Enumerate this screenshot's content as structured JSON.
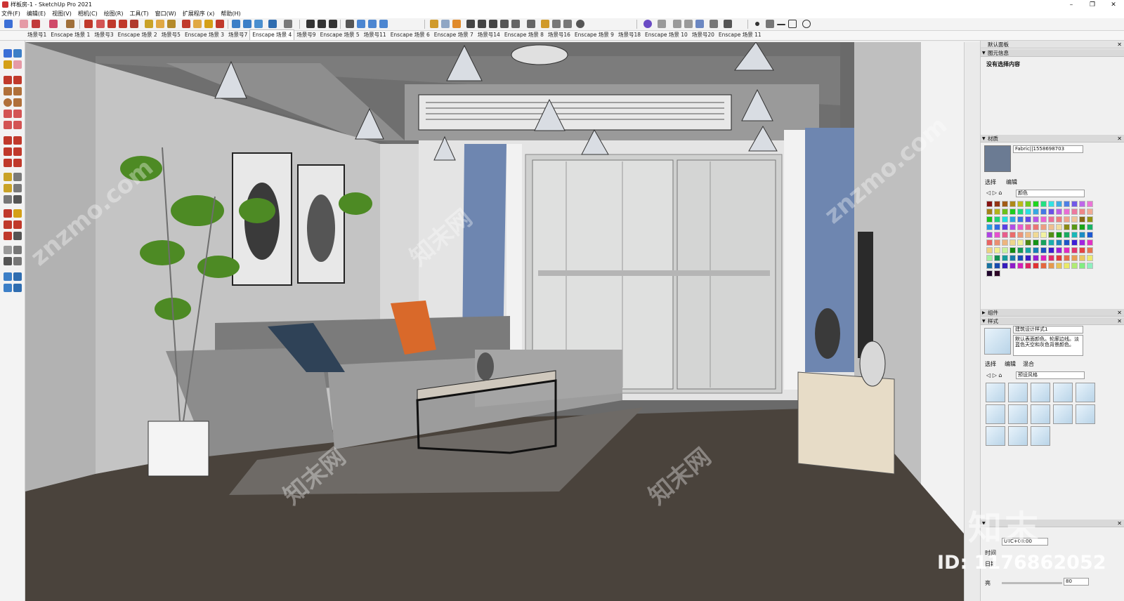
{
  "window": {
    "title": "样板房-1 - SketchUp Pro 2021",
    "minimize": "–",
    "restore": "❐",
    "close": "✕"
  },
  "menu": [
    "文件(F)",
    "编辑(E)",
    "视图(V)",
    "相机(C)",
    "绘图(R)",
    "工具(T)",
    "窗口(W)",
    "扩展程序 (x)",
    "帮助(H)"
  ],
  "scenes": [
    "场景号1",
    "Enscape 场景 1",
    "场景号3",
    "Enscape 场景 2",
    "场景号5",
    "Enscape 场景 3",
    "场景号7",
    "Enscape 场景 4",
    "场景号9",
    "Enscape 场景 5",
    "场景号11",
    "Enscape 场景 6",
    "Enscape 场景 7",
    "场景号14",
    "Enscape 场景 8",
    "场景号16",
    "Enscape 场景 9",
    "场景号18",
    "Enscape 场景 10",
    "场景号20",
    "Enscape 场景 11"
  ],
  "active_scene_index": 7,
  "tray": {
    "default_panel": "默认面板",
    "entity_info": {
      "title": "图元信息",
      "empty": "没有选择内容"
    },
    "materials": {
      "title": "材质",
      "material_name": "Fabric||1558698703",
      "tab_select": "选择",
      "tab_edit": "编辑",
      "library": "颜色",
      "swatch_color": "#6b7b93"
    },
    "components": {
      "title": "组件"
    },
    "styles": {
      "title": "样式",
      "style_name": "建筑设计样式1",
      "description": "默认表面颜色。轮廓边线。淡蓝色天空和灰色背景颜色。",
      "tab_select": "选择",
      "tab_edit": "编辑",
      "tab_mix": "混合",
      "library": "预设风格"
    },
    "shadows": {
      "timezone": "UTC+08:00",
      "time_label": "时间",
      "date_label": "日期",
      "light_label": "亮",
      "light_value": "80"
    }
  },
  "watermark": {
    "logo": "知末",
    "id": "ID: 1176862052",
    "site": "znzmo.com",
    "site_cn": "知末网"
  },
  "colors": {
    "wall": "#c9c9c9",
    "ceiling": "#8a8a8a",
    "floor": "#4a433c",
    "curtain": "#6e86b0",
    "pillow": "#d9692a",
    "sofa": "#8c8c8c"
  },
  "icons": [
    "select-icon",
    "eraser-icon",
    "pencil-icon",
    "paint-bucket-icon",
    "orbit-icon",
    "pan-icon",
    "zoom-icon",
    "tape-measure-icon",
    "scenes-icon",
    "camera-icon",
    "warehouse-icon",
    "enscape-icon"
  ]
}
